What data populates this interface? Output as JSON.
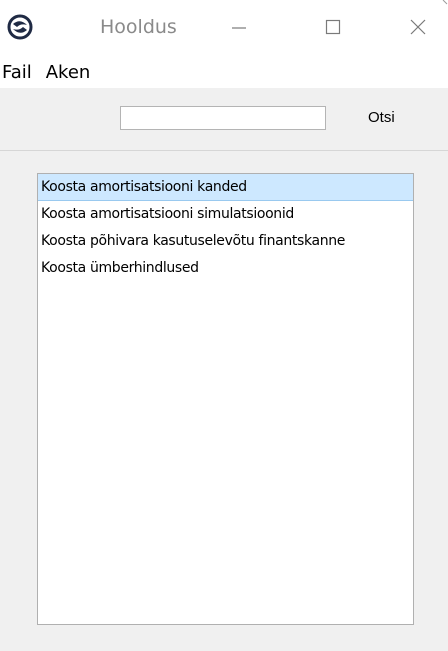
{
  "window": {
    "title": "Hooldus",
    "icon": "app-logo-icon",
    "controls": [
      "minimize-icon",
      "maximize-icon",
      "close-icon"
    ]
  },
  "menu": {
    "items": [
      {
        "label": "Fail"
      },
      {
        "label": "Aken"
      }
    ]
  },
  "toolbar": {
    "search_value": "",
    "search_placeholder": "",
    "search_button_label": "Otsi"
  },
  "list": {
    "selected_index": 0,
    "items": [
      {
        "label": "Koosta amortisatsiooni kanded"
      },
      {
        "label": "Koosta amortisatsiooni simulatsioonid"
      },
      {
        "label": "Koosta põhivara kasutuselevõtu finantskanne"
      },
      {
        "label": "Koosta ümberhindlused"
      }
    ]
  },
  "colors": {
    "selection": "#cde8ff",
    "title_text": "#8a8a8a",
    "background": "#f0f0f0"
  }
}
